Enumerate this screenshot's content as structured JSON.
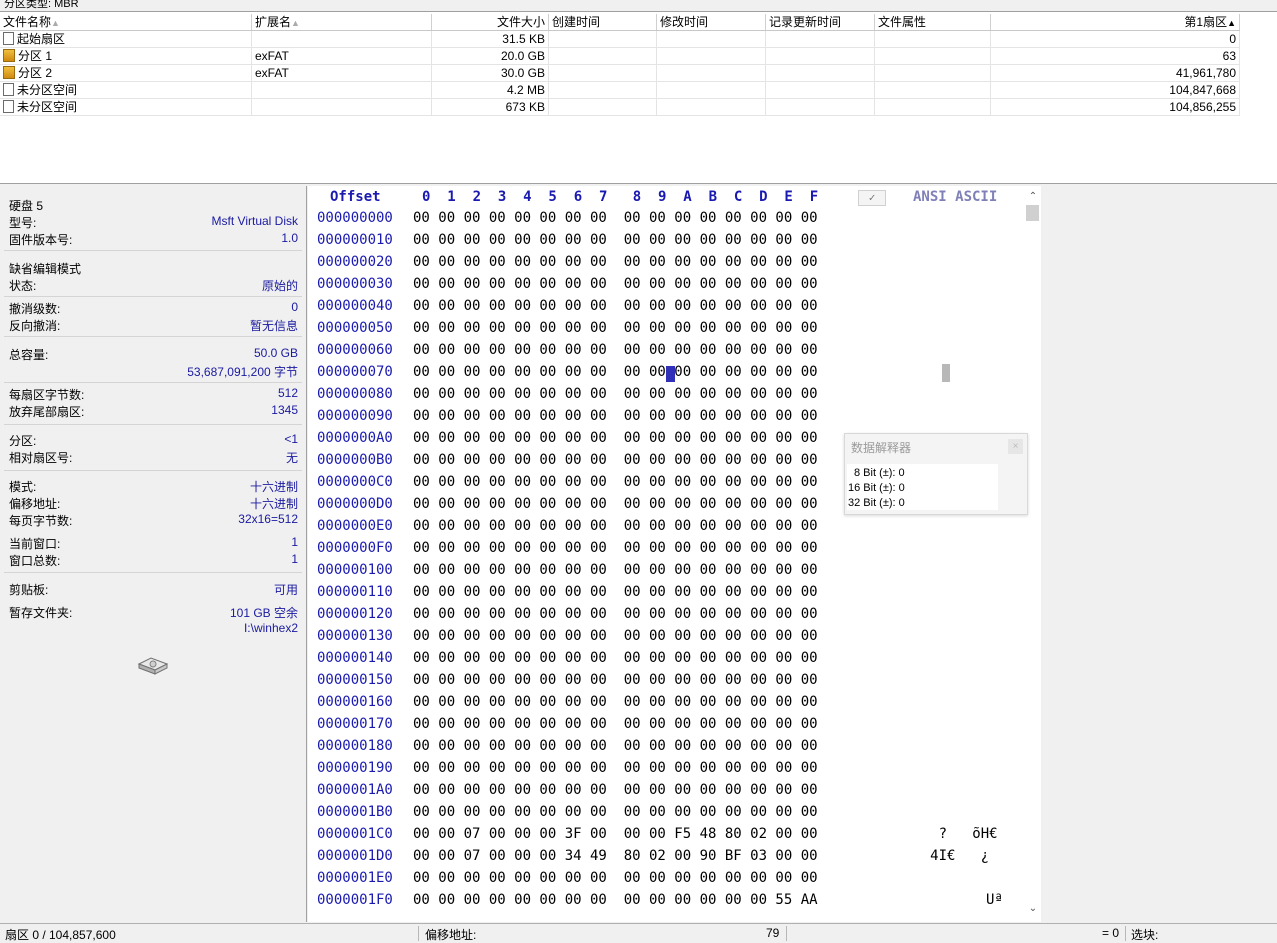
{
  "partition_type": "分区类型: MBR",
  "file_list": {
    "columns": [
      "文件名称",
      "扩展名",
      "文件大小",
      "创建时间",
      "修改时间",
      "记录更新时间",
      "文件属性",
      "第1扇区"
    ],
    "rows": [
      {
        "name": "起始扇区",
        "ext": "",
        "size": "31.5 KB",
        "first_sector": "0",
        "icon": "file-icon"
      },
      {
        "name": "分区 1",
        "ext": "exFAT",
        "size": "20.0 GB",
        "first_sector": "63",
        "icon": "partition-icon"
      },
      {
        "name": "分区 2",
        "ext": "exFAT",
        "size": "30.0 GB",
        "first_sector": "41,961,780",
        "icon": "partition-icon"
      },
      {
        "name": "未分区空间",
        "ext": "",
        "size": "4.2 MB",
        "first_sector": "104,847,668",
        "icon": "file-icon"
      },
      {
        "name": "未分区空间",
        "ext": "",
        "size": "673 KB",
        "first_sector": "104,856,255",
        "icon": "file-icon"
      }
    ]
  },
  "info": {
    "disk_title": "硬盘 5",
    "model_label": "型号:",
    "model_value": "Msft Virtual Disk",
    "firmware_label": "固件版本号:",
    "firmware_value": "1.0",
    "edit_mode_title": "缺省编辑模式",
    "state_label": "状态:",
    "state_value": "原始的",
    "undo_label": "撤消级数:",
    "undo_value": "0",
    "reverse_undo_label": "反向撤消:",
    "reverse_undo_value": "暂无信息",
    "capacity_label": "总容量:",
    "capacity_value": "50.0 GB",
    "capacity_bytes": "53,687,091,200 字节",
    "bytes_per_sector_label": "每扇区字节数:",
    "bytes_per_sector_value": "512",
    "surplus_sectors_label": "放弃尾部扇区:",
    "surplus_sectors_value": "1345",
    "partition_label": "分区:",
    "partition_value": "<1",
    "relative_sector_label": "相对扇区号:",
    "relative_sector_value": "无",
    "mode_label": "模式:",
    "mode_value": "十六进制",
    "offset_label": "偏移地址:",
    "offset_value": "十六进制",
    "bytes_per_page_label": "每页字节数:",
    "bytes_per_page_value": "32x16=512",
    "current_window_label": "当前窗口:",
    "current_window_value": "1",
    "total_windows_label": "窗口总数:",
    "total_windows_value": "1",
    "clipboard_label": "剪贴板:",
    "clipboard_value": "可用",
    "temp_folder_label": "暂存文件夹:",
    "temp_folder_value": "101 GB 空余",
    "temp_folder_path": "I:\\winhex2"
  },
  "hex": {
    "offset_header": "Offset",
    "column_header": "0  1  2  3  4  5  6  7   8  9  A  B  C  D  E  F",
    "ascii_header": "ANSI ASCII",
    "offsets": [
      "000000000",
      "000000010",
      "000000020",
      "000000030",
      "000000040",
      "000000050",
      "000000060",
      "000000070",
      "000000080",
      "000000090",
      "0000000A0",
      "0000000B0",
      "0000000C0",
      "0000000D0",
      "0000000E0",
      "0000000F0",
      "000000100",
      "000000110",
      "000000120",
      "000000130",
      "000000140",
      "000000150",
      "000000160",
      "000000170",
      "000000180",
      "000000190",
      "0000001A0",
      "0000001B0",
      "0000001C0",
      "0000001D0",
      "0000001E0",
      "0000001F0"
    ],
    "rows": [
      "00 00 00 00 00 00 00 00  00 00 00 00 00 00 00 00",
      "00 00 00 00 00 00 00 00  00 00 00 00 00 00 00 00",
      "00 00 00 00 00 00 00 00  00 00 00 00 00 00 00 00",
      "00 00 00 00 00 00 00 00  00 00 00 00 00 00 00 00",
      "00 00 00 00 00 00 00 00  00 00 00 00 00 00 00 00",
      "00 00 00 00 00 00 00 00  00 00 00 00 00 00 00 00",
      "00 00 00 00 00 00 00 00  00 00 00 00 00 00 00 00",
      "00 00 00 00 00 00 00 00  00 00 00 00 00 00 00 00",
      "00 00 00 00 00 00 00 00  00 00 00 00 00 00 00 00",
      "00 00 00 00 00 00 00 00  00 00 00 00 00 00 00 00",
      "00 00 00 00 00 00 00 00  00 00 00 00 00 00 00 00",
      "00 00 00 00 00 00 00 00  00 00 00 00 00 00 00 00",
      "00 00 00 00 00 00 00 00  00 00 00 00 00 00 00 00",
      "00 00 00 00 00 00 00 00  00 00 00 00 00 00 00 00",
      "00 00 00 00 00 00 00 00  00 00 00 00 00 00 00 00",
      "00 00 00 00 00 00 00 00  00 00 00 00 00 00 00 00",
      "00 00 00 00 00 00 00 00  00 00 00 00 00 00 00 00",
      "00 00 00 00 00 00 00 00  00 00 00 00 00 00 00 00",
      "00 00 00 00 00 00 00 00  00 00 00 00 00 00 00 00",
      "00 00 00 00 00 00 00 00  00 00 00 00 00 00 00 00",
      "00 00 00 00 00 00 00 00  00 00 00 00 00 00 00 00",
      "00 00 00 00 00 00 00 00  00 00 00 00 00 00 00 00",
      "00 00 00 00 00 00 00 00  00 00 00 00 00 00 00 00",
      "00 00 00 00 00 00 00 00  00 00 00 00 00 00 00 00",
      "00 00 00 00 00 00 00 00  00 00 00 00 00 00 00 00",
      "00 00 00 00 00 00 00 00  00 00 00 00 00 00 00 00",
      "00 00 00 00 00 00 00 00  00 00 00 00 00 00 00 00",
      "00 00 00 00 00 00 00 00  00 00 00 00 00 00 00 00",
      "00 00 07 00 00 00 3F 00  00 00 F5 48 80 02 00 00",
      "00 00 07 00 00 00 34 49  80 02 00 90 BF 03 00 00",
      "00 00 00 00 00 00 00 00  00 00 00 00 00 00 00 00",
      "00 00 00 00 00 00 00 00  00 00 00 00 00 00 55 AA"
    ],
    "ascii": [
      "",
      "",
      "",
      "",
      "",
      "",
      "",
      "",
      "",
      "",
      "",
      "",
      "",
      "",
      "",
      "",
      "",
      "",
      "",
      "",
      "",
      "",
      "",
      "",
      "",
      "",
      "",
      "",
      "      ?   õH€",
      "     4I€   ¿",
      "",
      ""
    ],
    "ascii_last": "Uª"
  },
  "interpreter": {
    "title": "数据解释器",
    "line1": "8 Bit (±): 0",
    "line2": "16 Bit (±): 0",
    "line3": "32 Bit (±): 0"
  },
  "status": {
    "sector": "扇区 0 / 104,857,600",
    "offset_label": "偏移地址:",
    "offset_value": "79",
    "eq": "= 0",
    "block_label": "选块:"
  }
}
